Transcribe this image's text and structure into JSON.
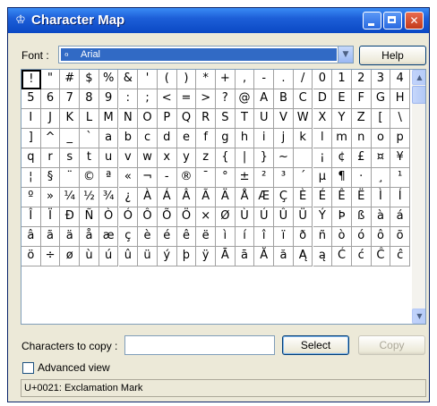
{
  "window": {
    "title": "Character Map",
    "app_icon": "character-map-icon",
    "controls": [
      "minimize",
      "maximize",
      "close"
    ],
    "accent": "#0a48c4"
  },
  "font": {
    "label": "Font :",
    "selected": "Arial",
    "font_icon": "opentype-font-icon"
  },
  "buttons": {
    "help": "Help",
    "select": "Select",
    "copy": "Copy"
  },
  "grid": {
    "columns": 20,
    "selected_index": 0,
    "characters": [
      "!",
      "\"",
      "#",
      "$",
      "%",
      "&",
      "'",
      "(",
      ")",
      "*",
      "+",
      ",",
      "-",
      ".",
      "/",
      "0",
      "1",
      "2",
      "3",
      "4",
      "5",
      "6",
      "7",
      "8",
      "9",
      ":",
      ";",
      "<",
      "=",
      ">",
      "?",
      "@",
      "A",
      "B",
      "C",
      "D",
      "E",
      "F",
      "G",
      "H",
      "I",
      "J",
      "K",
      "L",
      "M",
      "N",
      "O",
      "P",
      "Q",
      "R",
      "S",
      "T",
      "U",
      "V",
      "W",
      "X",
      "Y",
      "Z",
      "[",
      "\\",
      "]",
      "^",
      "_",
      "`",
      "a",
      "b",
      "c",
      "d",
      "e",
      "f",
      "g",
      "h",
      "i",
      "j",
      "k",
      "l",
      "m",
      "n",
      "o",
      "p",
      "q",
      "r",
      "s",
      "t",
      "u",
      "v",
      "w",
      "x",
      "y",
      "z",
      "{",
      "|",
      "}",
      "~",
      " ",
      "¡",
      "¢",
      "£",
      "¤",
      "¥",
      "¦",
      "§",
      "¨",
      "©",
      "ª",
      "«",
      "¬",
      "-",
      "®",
      "¯",
      "°",
      "±",
      "²",
      "³",
      "´",
      "µ",
      "¶",
      "·",
      "¸",
      "¹",
      "º",
      "»",
      "¼",
      "½",
      "¾",
      "¿",
      "À",
      "Á",
      "Â",
      "Ã",
      "Ä",
      "Å",
      "Æ",
      "Ç",
      "È",
      "É",
      "Ê",
      "Ë",
      "Ì",
      "Í",
      "Î",
      "Ï",
      "Ð",
      "Ñ",
      "Ò",
      "Ó",
      "Ô",
      "Õ",
      "Ö",
      "×",
      "Ø",
      "Ù",
      "Ú",
      "Û",
      "Ü",
      "Ý",
      "Þ",
      "ß",
      "à",
      "á",
      "â",
      "ã",
      "ä",
      "å",
      "æ",
      "ç",
      "è",
      "é",
      "ê",
      "ë",
      "ì",
      "í",
      "î",
      "ï",
      "ð",
      "ñ",
      "ò",
      "ó",
      "ô",
      "õ",
      "ö",
      "÷",
      "ø",
      "ù",
      "ú",
      "û",
      "ü",
      "ý",
      "þ",
      "ÿ",
      "Ā",
      "ā",
      "Ă",
      "ă",
      "Ą",
      "ą",
      "Ć",
      "ć",
      "Ĉ",
      "ĉ"
    ]
  },
  "copy": {
    "label": "Characters to copy :",
    "value": ""
  },
  "advanced": {
    "label": "Advanced view",
    "checked": false
  },
  "status": {
    "text": "U+0021: Exclamation Mark"
  }
}
